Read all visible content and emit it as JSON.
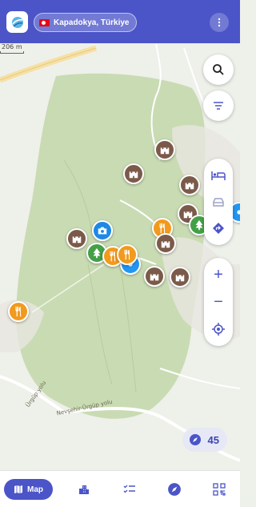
{
  "header": {
    "location": "Kapadokya, Türkiye",
    "flag": "turkey-flag",
    "menu_icon": "more-vertical-icon"
  },
  "map": {
    "scale_label": "206 m",
    "road_label_1": "Nevşehir-Ürgüp yolu",
    "road_label_2": "Ürgüp yolu",
    "colors": {
      "park": "#c9dbb3",
      "land": "#eef0ea",
      "road": "#f6e0a4",
      "accent": "#4b55c8"
    }
  },
  "controls": {
    "search_icon": "search-icon",
    "filter_icon": "filter-icon",
    "route_icons": [
      "bed-icon",
      "car-icon",
      "directions-icon"
    ],
    "zoom_in": "+",
    "zoom_out": "−",
    "locate_icon": "my-location-icon"
  },
  "place_count": {
    "icon": "compass-icon",
    "value": "45"
  },
  "bottom_nav": {
    "items": [
      {
        "label": "Map",
        "icon": "map-icon",
        "active": true
      },
      {
        "label": "",
        "icon": "buildings-icon",
        "active": false
      },
      {
        "label": "",
        "icon": "checklist-icon",
        "active": false
      },
      {
        "label": "",
        "icon": "compass-icon",
        "active": false
      },
      {
        "label": "",
        "icon": "qr-code-icon",
        "active": false
      }
    ]
  }
}
